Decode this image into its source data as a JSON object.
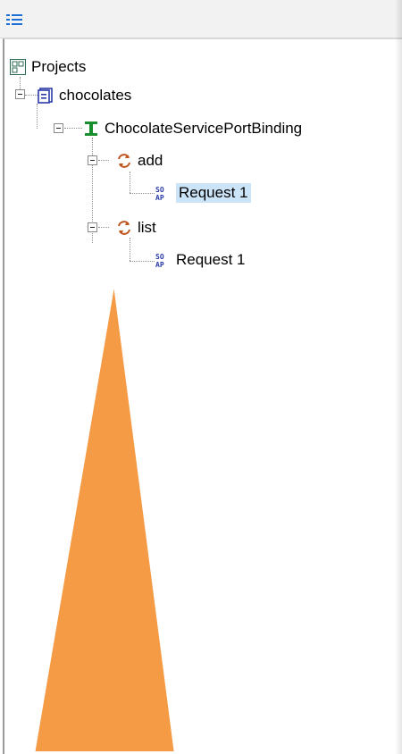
{
  "toolbar": {
    "icon": "tree-list-icon"
  },
  "tree": {
    "root": {
      "label": "Projects",
      "icon": "projects-icon"
    },
    "project": {
      "label": "chocolates",
      "icon": "project-icon"
    },
    "interface": {
      "label": "ChocolateServicePortBinding",
      "icon": "interface-icon"
    },
    "operations": [
      {
        "label": "add",
        "icon": "operation-icon",
        "requests": [
          {
            "label": "Request 1",
            "icon": "soap-request-icon",
            "selected": true
          }
        ]
      },
      {
        "label": "list",
        "icon": "operation-icon",
        "requests": [
          {
            "label": "Request 1",
            "icon": "soap-request-icon",
            "selected": false
          }
        ]
      }
    ]
  },
  "colors": {
    "selection": "#cce4f7",
    "callout": "#f59a45",
    "operation_icon": "#c0561f",
    "interface_icon": "#1a8f2d",
    "project_icon": "#2b3aa8"
  }
}
